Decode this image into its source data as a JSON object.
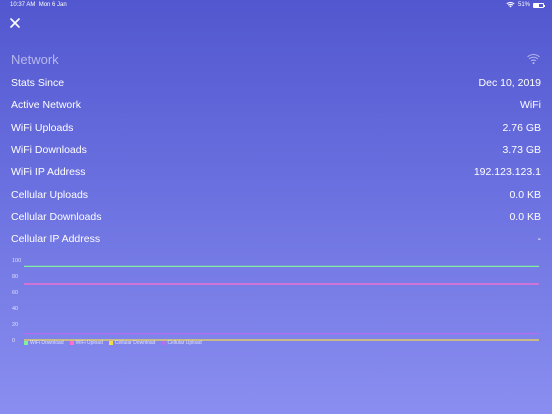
{
  "status_bar": {
    "time": "10:37 AM",
    "date": "Mon 6 Jan",
    "battery": "51%",
    "battery_level": 0.51
  },
  "header": {
    "close_icon": "close-icon"
  },
  "section": {
    "title": "Network",
    "icon": "wifi-icon"
  },
  "rows": [
    {
      "label": "Stats Since",
      "value": "Dec 10, 2019"
    },
    {
      "label": "Active Network",
      "value": "WiFi"
    },
    {
      "label": "WiFi Uploads",
      "value": "2.76 GB"
    },
    {
      "label": "WiFi Downloads",
      "value": "3.73 GB"
    },
    {
      "label": "WiFi IP Address",
      "value": "192.123.123.1"
    },
    {
      "label": "Cellular Uploads",
      "value": "0.0 KB"
    },
    {
      "label": "Cellular Downloads",
      "value": "0.0 KB"
    },
    {
      "label": "Cellular IP Address",
      "value": "-"
    }
  ],
  "chart_data": {
    "type": "line",
    "ylim": [
      0,
      100
    ],
    "yticks": [
      "0",
      "20",
      "40",
      "60",
      "80",
      "100"
    ],
    "series": [
      {
        "name": "WiFi Download",
        "color": "#7ef0a0",
        "values": [
          92,
          92
        ]
      },
      {
        "name": "WiFi Upload",
        "color": "#ff6fd0",
        "values": [
          70,
          70
        ]
      },
      {
        "name": "Cellular Download",
        "color": "#f5d94a",
        "values": [
          0,
          0
        ]
      },
      {
        "name": "Cellular Upload",
        "color": "#b46cf0",
        "values": [
          8,
          8
        ]
      }
    ]
  }
}
